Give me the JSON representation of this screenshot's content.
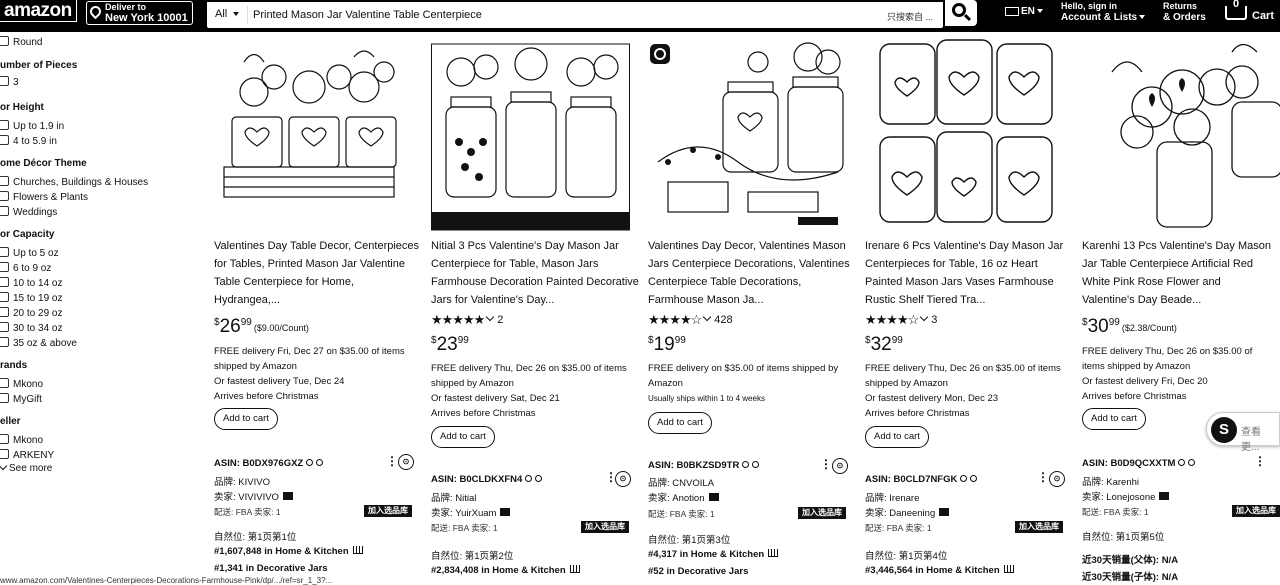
{
  "header": {
    "logo": "amazon",
    "deliver_line1": "Deliver to",
    "deliver_line2": "New York 10001",
    "search_category": "All",
    "search_value": "Printed Mason Jar Valentine Table Centerpiece",
    "ime_indicator": "只搜索自 ...",
    "lang": "EN",
    "account_line1": "Hello, sign in",
    "account_line2": "Account & Lists",
    "returns_line1": "Returns",
    "returns_line2": "& Orders",
    "cart_count": "0",
    "cart_label": "Cart"
  },
  "sidebar": {
    "shape_item": "Round",
    "pieces_title": "umber of Pieces",
    "pieces_item": "3",
    "height_title": "or Height",
    "height_items": [
      "Up to 1.9 in",
      "4 to 5.9 in"
    ],
    "theme_title": "ome Décor Theme",
    "theme_items": [
      "Churches, Buildings & Houses",
      "Flowers & Plants",
      "Weddings"
    ],
    "capacity_title": "or Capacity",
    "capacity_items": [
      "Up to 5 oz",
      "6 to 9 oz",
      "10 to 14 oz",
      "15 to 19 oz",
      "20 to 29 oz",
      "30 to 34 oz",
      "35 oz & above"
    ],
    "brands_title": "rands",
    "brands_items": [
      "Mkono",
      "MyGift"
    ],
    "seller_title": "eller",
    "seller_items": [
      "Mkono",
      "ARKENY"
    ],
    "see_more": "See more"
  },
  "products": [
    {
      "title": "Valentines Day Table Decor, Centerpieces for Tables, Printed Mason Jar Valentine Table Centerpiece for Home, Hydrangea,...",
      "rating_count": "",
      "price_whole": "26",
      "price_frac": "99",
      "unit_price": "($9.00/Count)",
      "delivery_line1": "FREE delivery Fri, Dec 27 on $35.00 of items shipped by Amazon",
      "delivery_line2": "Or fastest delivery Tue, Dec 24",
      "delivery_line3": "Arrives before Christmas",
      "add_to_cart": "Add to cart",
      "asin": "ASIN: B0DX976GXZ",
      "brand": "品牌: KIVIVO",
      "seller": "卖家: VIVIVIVO",
      "fba": "配送: FBA   卖家: 1",
      "fba_tag": "加入选品库",
      "rank_label": "自然位:  第1页第1位",
      "rank1": "#1,607,848",
      "rank1_cat": "in Home & Kitchen",
      "rank2": "#1,341",
      "rank2_cat": "in Decorative Jars"
    },
    {
      "title": "Nitial 3 Pcs Valentine's Day Mason Jar Centerpiece for Table, Mason Jars Farmhouse Decoration Painted Decorative Jars for Valentine's Day...",
      "rating_count": "2",
      "price_whole": "23",
      "price_frac": "99",
      "unit_price": "",
      "delivery_line1": "FREE delivery Thu, Dec 26 on $35.00 of items shipped by Amazon",
      "delivery_line2": "Or fastest delivery Sat, Dec 21",
      "delivery_line3": "Arrives before Christmas",
      "add_to_cart": "Add to cart",
      "asin": "ASIN: B0CLDKXFN4",
      "brand": "品牌: Nitial",
      "seller": "卖家: YuirXuam",
      "fba": "配送: FBA   卖家: 1",
      "fba_tag": "加入选品库",
      "rank_label": "自然位:  第1页第2位",
      "rank1": "#2,834,408",
      "rank1_cat": "in Home & Kitchen",
      "rank2": "",
      "rank2_cat": ""
    },
    {
      "title": "Valentines Day Decor, Valentines Mason Jars Centerpiece Decorations, Valentines Centerpiece Table Decorations, Farmhouse Mason Ja...",
      "rating_count": "428",
      "price_whole": "19",
      "price_frac": "99",
      "unit_price": "",
      "delivery_line1": "FREE delivery on $35.00 of items shipped by Amazon",
      "delivery_line2": "Usually ships within 1 to 4 weeks",
      "delivery_line3": "",
      "add_to_cart": "Add to cart",
      "asin": "ASIN: B0BKZSD9TR",
      "brand": "品牌: CNVOILA",
      "seller": "卖家: Anotion",
      "fba": "配送: FBA   卖家: 1",
      "fba_tag": "加入选品库",
      "rank_label": "自然位:  第1页第3位",
      "rank1": "#4,317",
      "rank1_cat": "in Home & Kitchen",
      "rank2": "#52",
      "rank2_cat": "in Decorative Jars"
    },
    {
      "title": "Irenare 6 Pcs Valentine's Day Mason Jar Centerpieces for Table, 16 oz Heart Painted Mason Jars Vases Farmhouse Rustic Shelf Tiered Tra...",
      "rating_count": "3",
      "price_whole": "32",
      "price_frac": "99",
      "unit_price": "",
      "delivery_line1": "FREE delivery Thu, Dec 26 on $35.00 of items shipped by Amazon",
      "delivery_line2": "Or fastest delivery Mon, Dec 23",
      "delivery_line3": "Arrives before Christmas",
      "add_to_cart": "Add to cart",
      "asin": "ASIN: B0CLD7NFGK",
      "brand": "品牌: Irenare",
      "seller": "卖家: Daneening",
      "fba": "配送: FBA   卖家: 1",
      "fba_tag": "加入选品库",
      "rank_label": "自然位:  第1页第4位",
      "rank1": "#3,446,564",
      "rank1_cat": "in Home & Kitchen",
      "rank2": "",
      "rank2_cat": ""
    },
    {
      "title": "Karenhi 13 Pcs Valentine's Day Mason Jar Table Centerpiece Artificial Red White Pink Rose Flower and Valentine's Day Beade...",
      "rating_count": "",
      "price_whole": "30",
      "price_frac": "99",
      "unit_price": "($2.38/Count)",
      "delivery_line1": "FREE delivery Thu, Dec 26 on $35.00 of items shipped by Amazon",
      "delivery_line2": "Or fastest delivery Fri, Dec 20",
      "delivery_line3": "Arrives before Christmas",
      "add_to_cart": "Add to cart",
      "asin": "ASIN: B0D9QCXXTM",
      "brand": "品牌: Karenhi",
      "seller": "卖家: Lonejosone",
      "fba": "配送: FBA   卖家: 1",
      "fba_tag": "加入选品库",
      "rank_label": "自然位:  第1页第5位",
      "rank1": "近30天销量(父体): N/A",
      "rank1_cat": "",
      "rank2": "近30天销量(子体): N/A",
      "rank2_cat": ""
    }
  ],
  "floating_widget_text": "查看更...",
  "status_url": "www.amazon.com/Valentines-Centerpieces-Decorations-Farmhouse-Pink/dp/.../ref=sr_1_3?..."
}
